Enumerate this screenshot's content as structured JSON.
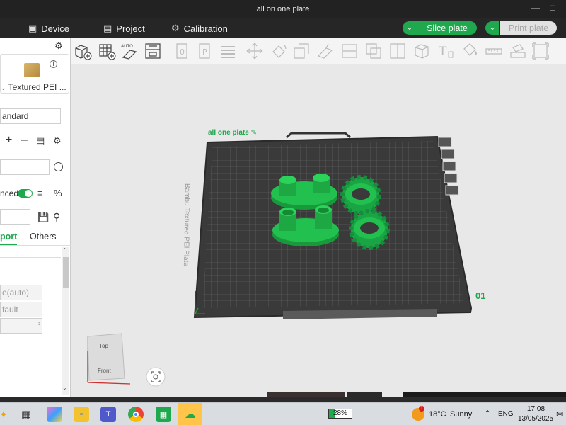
{
  "window": {
    "title": "all on one plate"
  },
  "menubar": {
    "device": "Device",
    "project": "Project",
    "calibration": "Calibration",
    "slice_label": "Slice plate",
    "print_label": "Print plate"
  },
  "sidebar": {
    "plate_type": "Textured PEI ...",
    "process_value": "andard",
    "advanced_label": "nced",
    "tab_support": "port",
    "tab_others": "Others",
    "field1": "e(auto)",
    "field2": "fault"
  },
  "viewport": {
    "plate_name": "all one plate",
    "plate_text": "Bambu Textured PEI Plate",
    "plate_number": "01",
    "view_top": "Top",
    "view_front": "Front"
  },
  "taskbar": {
    "battery": "28%",
    "weather_temp": "18°C",
    "weather_desc": "Sunny",
    "lang": "ENG",
    "time": "17:08",
    "date": "13/05/2025",
    "weather_badge": "1"
  },
  "colors": {
    "accent": "#1fa84d",
    "model": "#20b84a",
    "plate": "#3a3a3a"
  }
}
